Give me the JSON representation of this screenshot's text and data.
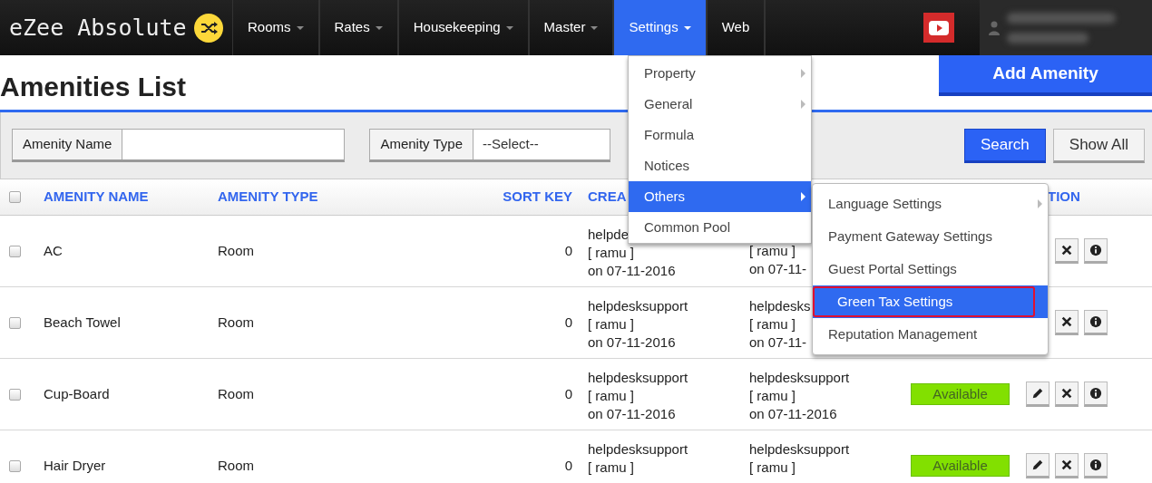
{
  "navbar": {
    "logo": "eZee Absolute",
    "items": [
      {
        "label": "Rooms",
        "dropdown": true,
        "selected": false
      },
      {
        "label": "Rates",
        "dropdown": true,
        "selected": false
      },
      {
        "label": "Housekeeping",
        "dropdown": true,
        "selected": false
      },
      {
        "label": "Master",
        "dropdown": true,
        "selected": false
      },
      {
        "label": "Settings",
        "dropdown": true,
        "selected": true
      },
      {
        "label": "Web",
        "dropdown": false,
        "selected": false
      }
    ]
  },
  "page_title": "Amenities List",
  "add_button": "Add Amenity",
  "filters": [
    {
      "label": "Amenity Name",
      "kind": "text"
    },
    {
      "label": "Amenity Type",
      "kind": "select",
      "value": "--Select--"
    }
  ],
  "filter_buttons": [
    {
      "label": "Search",
      "kind": "primary"
    },
    {
      "label": "Show All",
      "kind": "secondary"
    }
  ],
  "table": {
    "all_checked": false,
    "columns": [
      "AMENITY NAME",
      "AMENITY TYPE",
      "SORT KEY",
      "CREA",
      "TION"
    ],
    "rows": [
      {
        "checked": false,
        "name": "AC",
        "type": "Room",
        "sort_key": "0",
        "created": [
          "helpde",
          "[ ramu ]",
          "on 07-11-2016"
        ],
        "updated": [
          "[ ramu ]",
          "on 07-11-"
        ],
        "edit_visible": false
      },
      {
        "checked": false,
        "name": "Beach Towel",
        "type": "Room",
        "sort_key": "0",
        "created": [
          "helpdesksupport",
          "[ ramu ]",
          "on 07-11-2016"
        ],
        "updated": [
          "helpdesks",
          "[ ramu ]",
          "on 07-11-"
        ],
        "edit_visible": false
      },
      {
        "checked": false,
        "name": "Cup-Board",
        "type": "Room",
        "sort_key": "0",
        "created": [
          "helpdesksupport",
          "[ ramu ]",
          "on 07-11-2016"
        ],
        "updated": [
          "helpdesksupport",
          "[ ramu ]",
          "on 07-11-2016"
        ],
        "status": "Available",
        "edit_visible": true
      },
      {
        "checked": false,
        "name": "Hair Dryer",
        "type": "Room",
        "sort_key": "0",
        "created": [
          "helpdesksupport",
          "[ ramu ]"
        ],
        "updated": [
          "helpdesksupport",
          "[ ramu ]"
        ],
        "status": "Available",
        "edit_visible": true
      }
    ]
  },
  "settings_menu": [
    {
      "label": "Property",
      "submenu": true,
      "selected": false
    },
    {
      "label": "General",
      "submenu": true,
      "selected": false
    },
    {
      "label": "Formula",
      "submenu": false,
      "selected": false
    },
    {
      "label": "Notices",
      "submenu": false,
      "selected": false
    },
    {
      "label": "Others",
      "submenu": true,
      "selected": true
    },
    {
      "label": "Common Pool",
      "submenu": false,
      "selected": false
    }
  ],
  "others_menu": [
    {
      "label": "Language Settings",
      "submenu": true,
      "selected": false
    },
    {
      "label": "Payment Gateway Settings",
      "submenu": false,
      "selected": false
    },
    {
      "label": "Guest Portal Settings",
      "submenu": false,
      "selected": false
    },
    {
      "label": "Green Tax Settings",
      "submenu": false,
      "selected": true
    },
    {
      "label": "Reputation Management",
      "submenu": false,
      "selected": false
    }
  ]
}
